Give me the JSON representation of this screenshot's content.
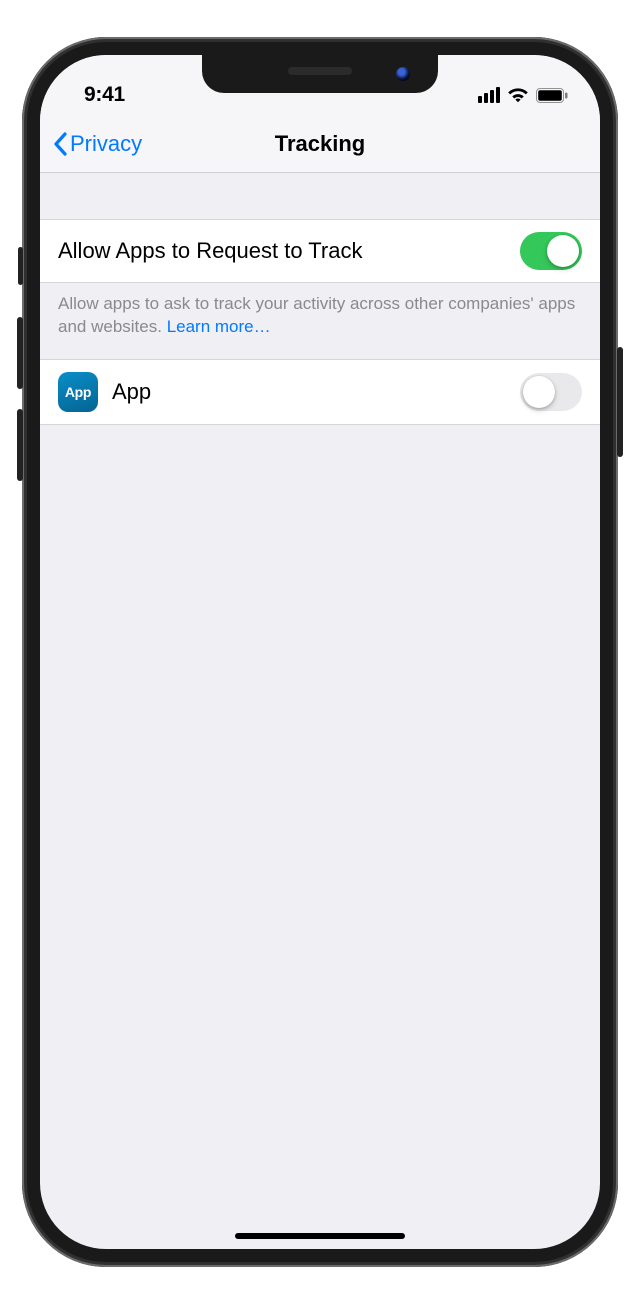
{
  "statusbar": {
    "time": "9:41"
  },
  "nav": {
    "back_label": "Privacy",
    "title": "Tracking"
  },
  "main_toggle": {
    "label": "Allow Apps to Request to Track",
    "value": true
  },
  "footer": {
    "text": "Allow apps to ask to track your activity across other companies' apps and websites. ",
    "link": "Learn more…"
  },
  "apps": [
    {
      "icon_text": "App",
      "name": "App",
      "value": false
    }
  ],
  "colors": {
    "accent": "#007aff",
    "toggle_on": "#34c759"
  }
}
